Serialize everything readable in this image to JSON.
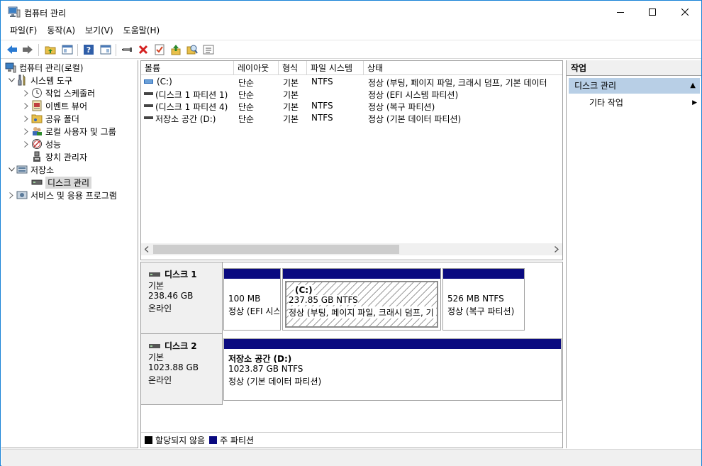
{
  "window": {
    "title": "컴퓨터 관리"
  },
  "menu": [
    "파일(F)",
    "동작(A)",
    "보기(V)",
    "도움말(H)"
  ],
  "tree": {
    "root": "컴퓨터 관리(로컬)",
    "system_tools": "시스템 도구",
    "task_scheduler": "작업 스케줄러",
    "event_viewer": "이벤트 뷰어",
    "shared_folders": "공유 폴더",
    "local_users": "로컬 사용자 및 그룹",
    "performance": "성능",
    "device_manager": "장치 관리자",
    "storage": "저장소",
    "disk_management": "디스크 관리",
    "services": "서비스 및 응용 프로그램"
  },
  "volume_list": {
    "columns": [
      "볼륨",
      "레이아웃",
      "형식",
      "파일 시스템",
      "상태"
    ],
    "rows": [
      {
        "volume": "(C:)",
        "layout": "단순",
        "type": "기본",
        "fs": "NTFS",
        "status": "정상 (부팅, 페이지 파일, 크래시 덤프, 기본 데이터"
      },
      {
        "volume": "(디스크 1 파티션 1)",
        "layout": "단순",
        "type": "기본",
        "fs": "",
        "status": "정상 (EFI 시스템 파티션)"
      },
      {
        "volume": "(디스크 1 파티션 4)",
        "layout": "단순",
        "type": "기본",
        "fs": "NTFS",
        "status": "정상 (복구 파티션)"
      },
      {
        "volume": "저장소 공간 (D:)",
        "layout": "단순",
        "type": "기본",
        "fs": "NTFS",
        "status": "정상 (기본 데이터 파티션)"
      }
    ]
  },
  "disks": [
    {
      "name": "디스크 1",
      "type": "기본",
      "size": "238.46 GB",
      "state": "온라인",
      "partitions": [
        {
          "title": "",
          "size": "100 MB",
          "status": "정상 (EFI 시스"
        },
        {
          "title": "(C:)",
          "size": "237.85 GB NTFS",
          "status": "정상 (부팅, 페이지 파일, 크래시 덤프, 기"
        },
        {
          "title": "",
          "size": "526 MB NTFS",
          "status": "정상 (복구 파티션)"
        }
      ]
    },
    {
      "name": "디스크 2",
      "type": "기본",
      "size": "1023.88 GB",
      "state": "온라인",
      "partitions": [
        {
          "title": "저장소 공간  (D:)",
          "size": "1023.87 GB NTFS",
          "status": "정상 (기본 데이터 파티션)"
        }
      ]
    }
  ],
  "legend": {
    "unallocated": "할당되지 않음",
    "primary": "주 파티션"
  },
  "actions": {
    "header": "작업",
    "section": "디스크 관리",
    "more": "기타 작업"
  },
  "colors": {
    "partition_header": "#0a0a80",
    "selection_bar": "#b8cfe6",
    "window_border": "#1883d7"
  }
}
